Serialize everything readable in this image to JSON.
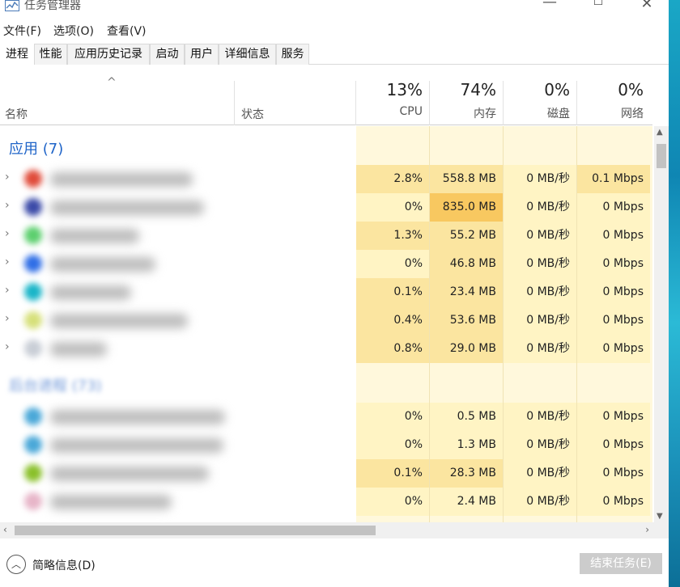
{
  "window": {
    "title": "任务管理器",
    "min_glyph": "—",
    "max_glyph": "☐",
    "close_glyph": "✕"
  },
  "menu": [
    "文件(F)",
    "选项(O)",
    "查看(V)"
  ],
  "tabs": [
    {
      "label": "进程",
      "active": true
    },
    {
      "label": "性能",
      "active": false
    },
    {
      "label": "应用历史记录",
      "active": false
    },
    {
      "label": "启动",
      "active": false
    },
    {
      "label": "用户",
      "active": false
    },
    {
      "label": "详细信息",
      "active": false
    },
    {
      "label": "服务",
      "active": false
    }
  ],
  "columns": {
    "sort_caret": "^",
    "name": "名称",
    "status": "状态",
    "metrics": [
      {
        "pct": "13%",
        "label": "CPU"
      },
      {
        "pct": "74%",
        "label": "内存"
      },
      {
        "pct": "0%",
        "label": "磁盘"
      },
      {
        "pct": "0%",
        "label": "网络"
      }
    ]
  },
  "groups": {
    "apps_title": "应用 (7)",
    "background_title": "后台进程 (73)"
  },
  "app_rows": [
    {
      "cpu": "2.8%",
      "mem": "558.8 MB",
      "disk": "0 MB/秒",
      "net": "0.1 Mbps",
      "icon_color": "#e04b3a"
    },
    {
      "cpu": "0%",
      "mem": "835.0 MB",
      "disk": "0 MB/秒",
      "net": "0 Mbps",
      "icon_color": "#3b4aa8"
    },
    {
      "cpu": "1.3%",
      "mem": "55.2 MB",
      "disk": "0 MB/秒",
      "net": "0 Mbps",
      "icon_color": "#5ccf6e"
    },
    {
      "cpu": "0%",
      "mem": "46.8 MB",
      "disk": "0 MB/秒",
      "net": "0 Mbps",
      "icon_color": "#2f6ee6"
    },
    {
      "cpu": "0.1%",
      "mem": "23.4 MB",
      "disk": "0 MB/秒",
      "net": "0 Mbps",
      "icon_color": "#19b5c8"
    },
    {
      "cpu": "0.4%",
      "mem": "53.6 MB",
      "disk": "0 MB/秒",
      "net": "0 Mbps",
      "icon_color": "#d6e07a"
    },
    {
      "cpu": "0.8%",
      "mem": "29.0 MB",
      "disk": "0 MB/秒",
      "net": "0 Mbps",
      "icon_color": "#c9ced6"
    }
  ],
  "bg_rows": [
    {
      "cpu": "0%",
      "mem": "0.5 MB",
      "disk": "0 MB/秒",
      "net": "0 Mbps",
      "icon_color": "#4aa8d8"
    },
    {
      "cpu": "0%",
      "mem": "1.3 MB",
      "disk": "0 MB/秒",
      "net": "0 Mbps",
      "icon_color": "#4aa8d8"
    },
    {
      "cpu": "0.1%",
      "mem": "28.3 MB",
      "disk": "0 MB/秒",
      "net": "0 Mbps",
      "icon_color": "#8ac02a"
    },
    {
      "cpu": "0%",
      "mem": "2.4 MB",
      "disk": "0 MB/秒",
      "net": "0 Mbps",
      "icon_color": "#e7b5c8"
    }
  ],
  "footer": {
    "toggle_label": "简略信息(D)",
    "end_task_label": "结束任务(E)"
  },
  "colors": {
    "group_title": "#1f64c8",
    "metric_light": "#fff4c4",
    "metric_medium": "#fbe5a0",
    "metric_high": "#f8c860"
  }
}
